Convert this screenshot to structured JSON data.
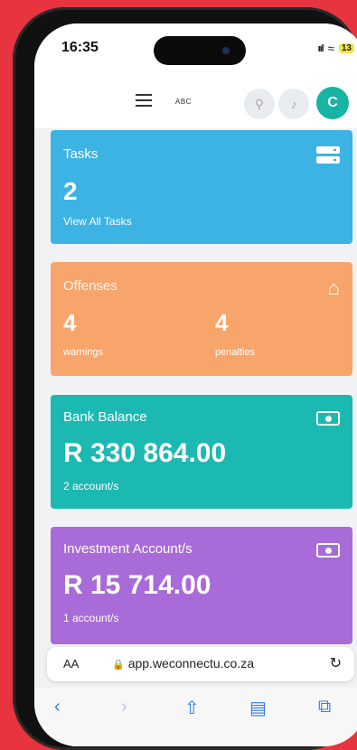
{
  "status_bar": {
    "time": "16:35",
    "signal": "ııl",
    "battery": "13"
  },
  "header": {
    "logo": "ABC",
    "avatar_initial": "C"
  },
  "cards": {
    "tasks": {
      "label": "Tasks",
      "count": "2",
      "link": "View All Tasks"
    },
    "offenses": {
      "label": "Offenses",
      "warnings_count": "4",
      "warnings_label": "warnings",
      "penalties_count": "4",
      "penalties_label": "penalties"
    },
    "bank": {
      "label": "Bank Balance",
      "amount": "R 330 864.00",
      "sub": "2 account/s"
    },
    "investment": {
      "label": "Investment Account/s",
      "amount": "R 15 714.00",
      "sub": "1 account/s"
    }
  },
  "browser": {
    "aa": "AA",
    "url": "app.weconnectu.co.za"
  },
  "colors": {
    "tasks": "#3cb3e3",
    "offenses": "#f7a56a",
    "bank": "#1bb9b2",
    "investment": "#a96bd8",
    "background": "#e8343f"
  }
}
